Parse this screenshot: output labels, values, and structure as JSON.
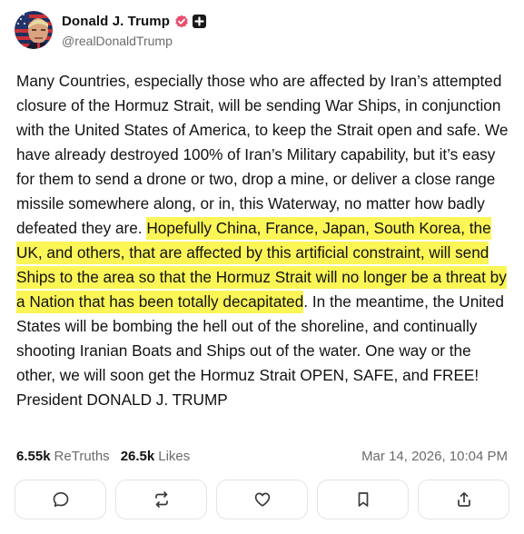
{
  "author": {
    "display_name": "Donald J. Trump",
    "handle": "@realDonaldTrump",
    "verified_icon": "verified-badge-icon",
    "plus_icon": "plus-badge-icon"
  },
  "post": {
    "text_before": "Many Countries, especially those who are affected by Iran’s attempted closure of the Hormuz Strait, will be sending War Ships, in conjunction with the United States of America, to keep the Strait open and safe. We have already destroyed 100% of Iran’s Military capability, but it’s easy for them to send a drone or two, drop a mine, or deliver a close range missile somewhere along, or in, this Waterway, no matter how badly defeated they are. ",
    "text_highlight": "Hopefully China, France, Japan, South Korea, the UK, and others, that are affected by this artificial constraint, will send Ships to the area so that the Hormuz Strait will no longer be a threat by a Nation that has been totally decapitated",
    "text_after": ". In the meantime, the United States will be bombing the hell out of the shoreline, and continually shooting Iranian Boats and Ships out of the water. One way or the other, we will soon get the Hormuz Strait OPEN, SAFE, and FREE! President DONALD J. TRUMP",
    "highlight_color": "#fbf556"
  },
  "stats": {
    "retruths_count": "6.55k",
    "retruths_label": "ReTruths",
    "likes_count": "26.5k",
    "likes_label": "Likes",
    "timestamp": "Mar 14, 2026, 10:04 PM"
  },
  "actions": [
    {
      "name": "reply-button",
      "icon": "comment-icon"
    },
    {
      "name": "retruth-button",
      "icon": "retruth-icon"
    },
    {
      "name": "like-button",
      "icon": "heart-icon"
    },
    {
      "name": "bookmark-button",
      "icon": "bookmark-icon"
    },
    {
      "name": "share-button",
      "icon": "share-icon"
    }
  ],
  "colors": {
    "verified_badge": "#e8506e",
    "muted_text": "#6b6b6b",
    "button_border": "#e4e4e4"
  }
}
